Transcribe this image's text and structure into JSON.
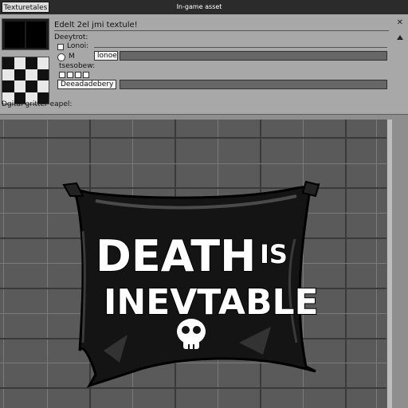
{
  "titlebar": {
    "tab_label": "Texturetales",
    "window_title": "In-game asset"
  },
  "panel": {
    "heading": "Edelt 2el jmi textule!",
    "section_label": "Deeytrot:",
    "option1_label": "Lonoi:",
    "option2_value": "M",
    "option2_field": "lonoe:",
    "option3_label": "tsesobew:",
    "dropdown_value": "Deeadadebery",
    "footer_label": "Dgital gritter eapel:"
  },
  "banner": {
    "line1_word": "DEATH",
    "line1_small": "IS",
    "line2": "INEVTABLE"
  },
  "colors": {
    "grid_bg": "#d9ecf4",
    "banner_fill": "#111111",
    "panel_bg": "#a8a8a8"
  },
  "icons": {
    "close": "close-icon",
    "skull": "skull-icon"
  }
}
